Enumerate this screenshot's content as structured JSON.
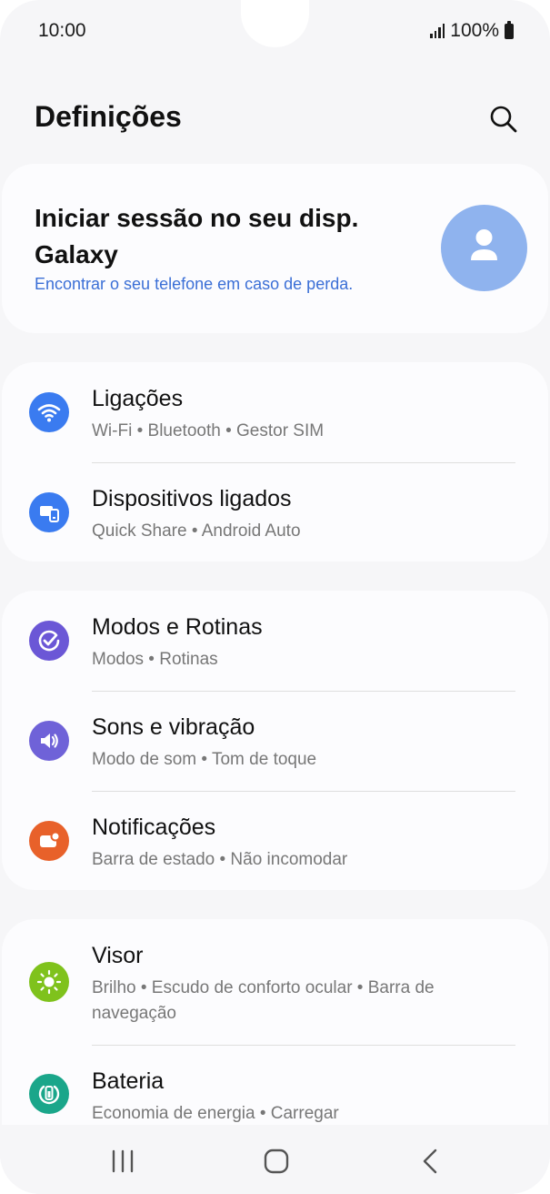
{
  "status_bar": {
    "time": "10:00",
    "battery": "100%"
  },
  "header": {
    "title": "Definições"
  },
  "account": {
    "title": "Iniciar sessão no seu disp. Galaxy",
    "link": "Encontrar o seu telefone em caso de perda."
  },
  "groups": [
    {
      "items": [
        {
          "title": "Ligações",
          "subtitle": "Wi-Fi  •  Bluetooth  •  Gestor SIM",
          "icon": "wifi-icon",
          "color": "#3a7bf0"
        },
        {
          "title": "Dispositivos ligados",
          "subtitle": "Quick Share  •  Android Auto",
          "icon": "devices-icon",
          "color": "#3a7bf0"
        }
      ]
    },
    {
      "items": [
        {
          "title": "Modos e Rotinas",
          "subtitle": "Modos  •  Rotinas",
          "icon": "check-circle-icon",
          "color": "#6b57d6"
        },
        {
          "title": "Sons e vibração",
          "subtitle": "Modo de som  •  Tom de toque",
          "icon": "speaker-icon",
          "color": "#6f62d8"
        },
        {
          "title": "Notificações",
          "subtitle": "Barra de estado  •  Não incomodar",
          "icon": "notification-icon",
          "color": "#e8612a"
        }
      ]
    },
    {
      "items": [
        {
          "title": "Visor",
          "subtitle": "Brilho  •  Escudo de conforto ocular  •  Barra de navegação",
          "icon": "sun-icon",
          "color": "#7fc21c"
        },
        {
          "title": "Bateria",
          "subtitle": "Economia de energia  •  Carregar",
          "icon": "battery-icon",
          "color": "#1aa68a"
        }
      ]
    }
  ]
}
